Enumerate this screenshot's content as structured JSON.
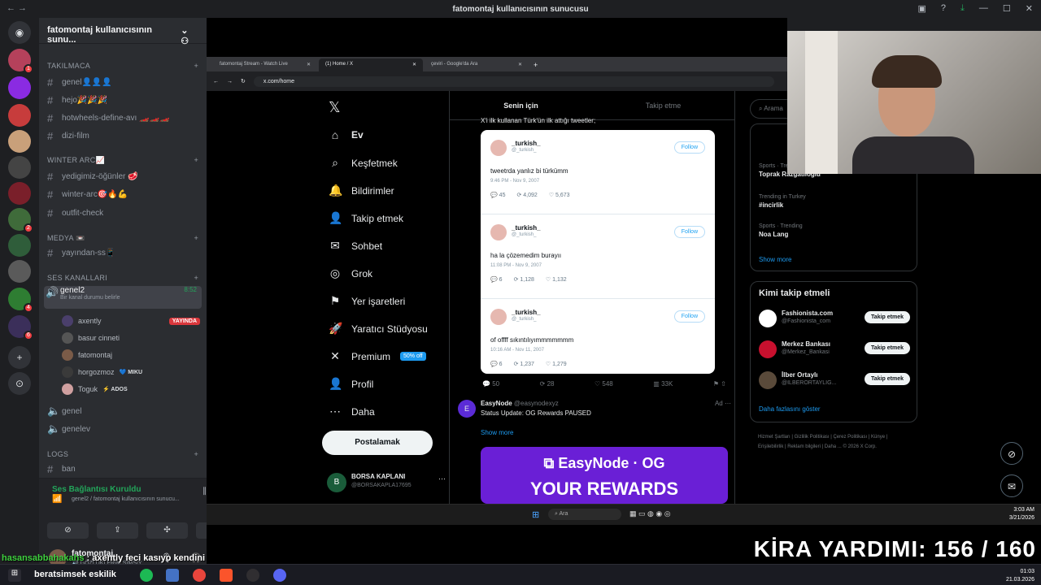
{
  "window": {
    "title": "fatomontaj kullanıcısının sunucusu"
  },
  "server": {
    "name": "fatomontaj kullanıcısının sunu..."
  },
  "categories": [
    {
      "label": "TAKILMACA"
    },
    {
      "label": "WINTER ARC📈"
    },
    {
      "label": "MEDYA 📼"
    },
    {
      "label": "Ses Kanalları"
    },
    {
      "label": "LOGS"
    }
  ],
  "channels": {
    "genel": "genel👤👤👤",
    "hejo": "hejo🎉🎉🎉",
    "hotwheels": "hotwheels-define-avı 🏎️🏎️🏎️",
    "dizi": "dizi-film",
    "yedigimiz": "yedigimiz-öğünler 🥩",
    "winter": "winter-arc🎯🔥💪",
    "outfit": "outfit-check",
    "yayindan": "yayından-ss📱",
    "genel2": "genel2",
    "genel2_time": "8:52",
    "genel2_status": "Bir kanal durumu belirle",
    "genelv": "genel",
    "genelev": "genelev",
    "ban": "ban"
  },
  "voice_users": [
    {
      "name": "axently",
      "tag": "YAYINDA"
    },
    {
      "name": "basur cinneti",
      "tag": ""
    },
    {
      "name": "fatomontaj",
      "tag": ""
    },
    {
      "name": "horgozmoz",
      "tag": "💙 MIKU"
    },
    {
      "name": "Toguk",
      "tag": "⚡ ADOS"
    }
  ],
  "voice_panel": {
    "title": "Ses Bağlantısı Kuruldu",
    "sub": "genel2 / fatomontaj kullanıcısının sunucu..."
  },
  "user": {
    "name": "fatomontaj",
    "status": "🔊 GÖZLÜKLERİM SİMSİY"
  },
  "browser": {
    "tabs": [
      "fatomontaj Stream - Watch Live",
      "(1) Home / X",
      "çeviri - Google'da Ara"
    ],
    "url": "x.com/home"
  },
  "x_nav": [
    {
      "icon": "home-icon",
      "glyph": "⌂",
      "label": "Ev"
    },
    {
      "icon": "search-icon",
      "glyph": "⌕",
      "label": "Keşfetmek"
    },
    {
      "icon": "bell-icon",
      "glyph": "🔔",
      "label": "Bildirimler"
    },
    {
      "icon": "person-plus-icon",
      "glyph": "👤",
      "label": "Takip etmek"
    },
    {
      "icon": "mail-icon",
      "glyph": "✉",
      "label": "Sohbet"
    },
    {
      "icon": "grok-icon",
      "glyph": "◎",
      "label": "Grok"
    },
    {
      "icon": "bookmark-icon",
      "glyph": "⚑",
      "label": "Yer işaretleri"
    },
    {
      "icon": "rocket-icon",
      "glyph": "🚀",
      "label": "Yaratıcı Stüdyosu"
    },
    {
      "icon": "x-icon",
      "glyph": "✕",
      "label": "Premium"
    },
    {
      "icon": "profile-icon",
      "glyph": "👤",
      "label": "Profil"
    },
    {
      "icon": "more-icon",
      "glyph": "⋯",
      "label": "Daha"
    }
  ],
  "premium_badge": "50% off",
  "post_button": "Postalamak",
  "account": {
    "name": "BORSA KAPLANI",
    "handle": "@BORSAKAPLA17695"
  },
  "feed_tabs": [
    "Senin için",
    "Takip etme"
  ],
  "feed_caption": "X'i ilk kullanan Türk'ün ilk attığı tweetler;",
  "tweets": [
    {
      "name": "_turkish_",
      "handle": "@_turkish_",
      "follow": "Follow",
      "text": "tweetrda yanlız bi türkümm",
      "date": "9:46 PM - Nov 9, 2007",
      "replies": "45",
      "rts": "4,092",
      "likes": "5,673"
    },
    {
      "name": "_turkish_",
      "handle": "@_turkish_",
      "follow": "Follow",
      "text": "ha la çözemedim burayıı",
      "date": "11:08 PM - Nov 9, 2007",
      "replies": "6",
      "rts": "1,128",
      "likes": "1,132"
    },
    {
      "name": "_turkish_",
      "handle": "@_turkish_",
      "follow": "Follow",
      "text": "of offff sıkıntılıyımmmmmmm",
      "date": "10:16 AM - Nov 11, 2007",
      "replies": "6",
      "rts": "1,237",
      "likes": "1,279"
    }
  ],
  "post_stats": {
    "replies": "50",
    "rts": "28",
    "likes": "548",
    "views": "33K"
  },
  "ad": {
    "name": "EasyNode",
    "handle": "@easynodexyz",
    "tag": "Ad",
    "text": "Status Update: OG Rewards PAUSED",
    "more": "Show more",
    "banner": "YOUR REWARDS",
    "brand": "EasyNode"
  },
  "search": {
    "placeholder": "Arama"
  },
  "trends": [
    {
      "meta": "Sports · Trending",
      "title": "Toprak Razgatlıoğlu"
    },
    {
      "meta": "Trending in Turkey",
      "title": "#incirlik"
    },
    {
      "meta": "Sports · Trending",
      "title": "Noa Lang"
    }
  ],
  "show_more": "Show more",
  "who_title": "Kimi takip etmeli",
  "who": [
    {
      "name": "Fashionista.com",
      "handle": "@Fashionista_com",
      "btn": "Takip etmek"
    },
    {
      "name": "Merkez Bankası",
      "handle": "@Merkez_Bankasi",
      "btn": "Takip etmek"
    },
    {
      "name": "İlber Ortaylı",
      "handle": "@ILBERORTAYLIG...",
      "btn": "Takip etmek"
    }
  ],
  "who_more": "Daha fazlasını göster",
  "footer_links": "Hizmet Şartları | Gizlilik Politikası | Çerez Politikası | Künye | Erişilebilirlik | Reklam bilgileri | Daha ... © 2026 X Corp.",
  "inner_taskbar": {
    "search": "Ara",
    "time": "3:03 AM",
    "date": "3/21/2026"
  },
  "overlay": {
    "kira": "KİRA YARDIMI:  156 / 160",
    "chat_user": "hasansabbahakahs",
    "chat_msg": " : axently feci kasıyo kendini"
  },
  "outer_taskbar": {
    "user": "beratsimsek eskilik",
    "time": "01:03",
    "date": "21.03.2026"
  }
}
